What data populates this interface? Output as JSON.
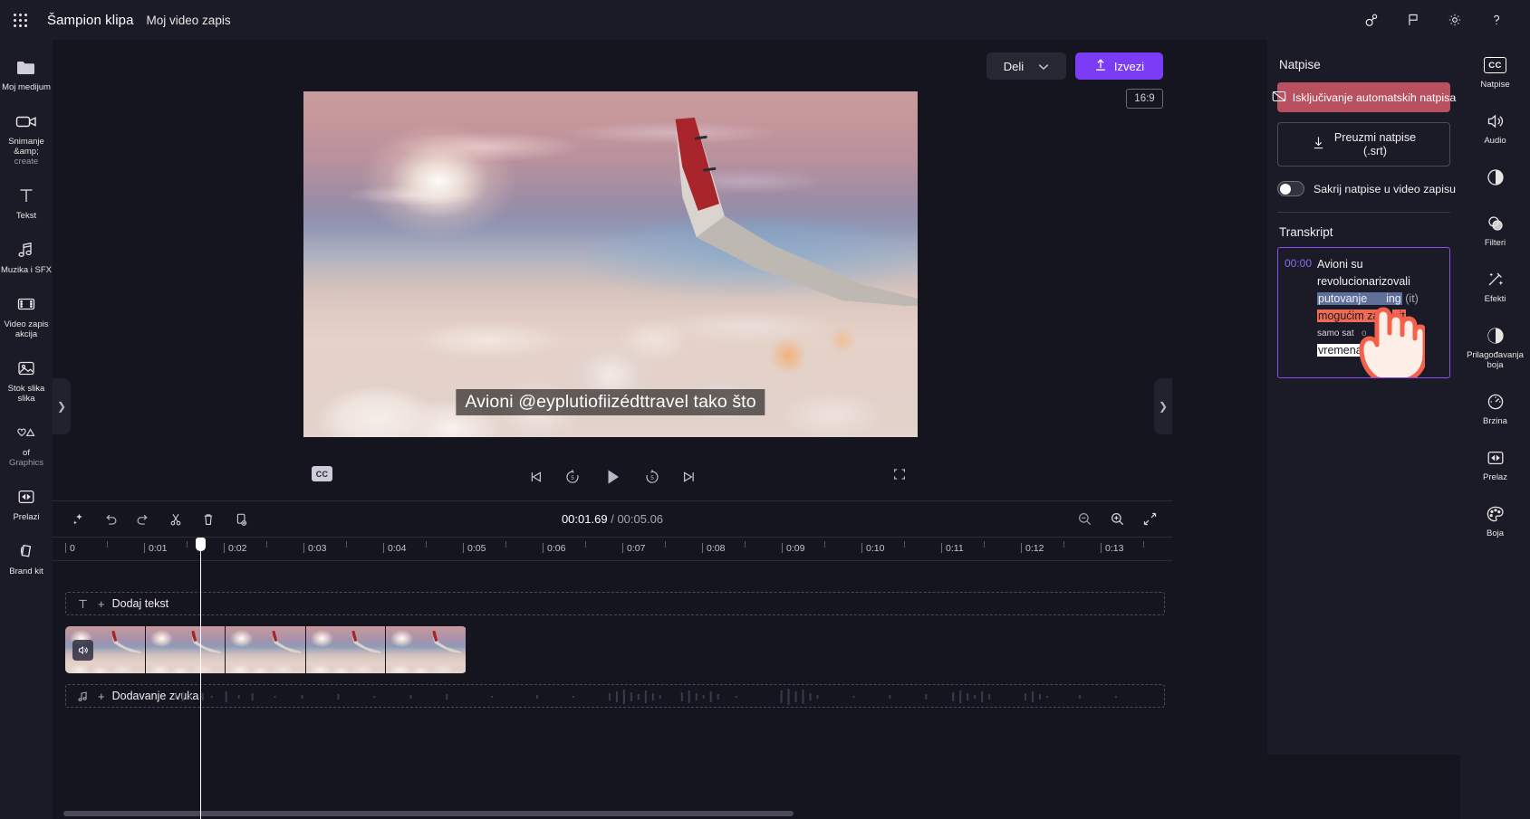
{
  "header": {
    "app_title": "Šampion klipa",
    "project_title": "Moj video zapis",
    "icons": [
      {
        "name": "people-share-icon",
        "label": "Deljenje"
      },
      {
        "name": "flag-feedback-icon",
        "label": "Povratne informacije"
      },
      {
        "name": "gear-settings-icon",
        "label": "Postavke"
      },
      {
        "name": "help-question-icon",
        "label": "Pomoć"
      }
    ]
  },
  "left_rail": {
    "items": [
      {
        "label": "Moj medijum",
        "icon": "folder-icon"
      },
      {
        "label": "Snimanje &amp;",
        "sub": "create",
        "icon": "camera-video-icon"
      },
      {
        "label": "Tekst",
        "icon": "text-t-icon"
      },
      {
        "label": "Muzika i SFX",
        "icon": "music-note-icon"
      },
      {
        "label": "Video zapis akcija",
        "icon": "film-strip-icon"
      },
      {
        "label": "Stok slika",
        "sub": "slika",
        "icon": "image-picture-icon"
      },
      {
        "label": "of",
        "sub": "Graphics",
        "icon": "heart-triangle-icon"
      },
      {
        "label": "Prelazi",
        "icon": "transition-icon"
      },
      {
        "label": "Brand kit",
        "icon": "brand-kit-icon"
      }
    ]
  },
  "preview": {
    "share_button": "Deli",
    "export_button": "Izvezi",
    "aspect_ratio": "16:9",
    "caption_text": "Avioni @eyplutiofiizédttravel tako što"
  },
  "playback": {
    "cc_label": "CC",
    "controls": [
      {
        "name": "skip-to-start-button"
      },
      {
        "name": "rewind-5-seconds-button",
        "value": "5"
      },
      {
        "name": "play-button"
      },
      {
        "name": "forward-5-seconds-button",
        "value": "5"
      },
      {
        "name": "skip-to-end-button"
      }
    ],
    "fullscreen": "fullscreen-button"
  },
  "captions_panel": {
    "title": "Natpise",
    "disable_auto_button": "Isključivanje automatskih natpisa",
    "download_srt_line1": "Preuzmi natpise",
    "download_srt_line2": "(.srt)",
    "hide_captions_label": "Sakrij natpise u video zapisu",
    "hide_captions_on": false,
    "transcript_title": "Transkript",
    "transcript": {
      "timestamp": "00:00",
      "lines": [
        {
          "segments": [
            {
              "text": "Avioni su",
              "style": "plain"
            }
          ]
        },
        {
          "segments": [
            {
              "text": "revolucionarizovali",
              "style": "plain"
            }
          ]
        },
        {
          "segments": [
            {
              "text": "putovanje",
              "style": "blue"
            },
            {
              "text": " ",
              "style": "blue"
            },
            {
              "text": "ing",
              "style": "blue"
            },
            {
              "text": " (it)",
              "style": "paren"
            }
          ]
        },
        {
          "segments": [
            {
              "text": "mogućim za",
              "style": "red"
            },
            {
              "text": "j u",
              "style": "plain"
            },
            {
              "text": "  it",
              "style": "red"
            }
          ]
        },
        {
          "segments": [
            {
              "text": "samo sat",
              "style": "small"
            }
          ]
        },
        {
          "segments": [
            {
              "text": "vremena. it",
              "style": "white"
            }
          ]
        }
      ]
    },
    "accent_border": "#8a4ff0",
    "danger_color": "#b8505f"
  },
  "right_rail": {
    "items": [
      {
        "label": "Natpise",
        "icon": "cc-captions-icon",
        "active": true
      },
      {
        "label": "Audio",
        "icon": "speaker-audio-icon"
      },
      {
        "label": "",
        "icon": "contrast-circle-icon"
      },
      {
        "label": "Filteri",
        "icon": "filters-overlap-icon"
      },
      {
        "label": "Efekti",
        "icon": "magic-wand-effects-icon"
      },
      {
        "label": "Prilagođavanja",
        "sub": "boja",
        "icon": "color-adjust-icon"
      },
      {
        "label": "Brzina",
        "icon": "speedometer-icon"
      },
      {
        "label": "Prelaz",
        "icon": "transition-icon"
      },
      {
        "label": "Boja",
        "icon": "palette-color-icon"
      }
    ]
  },
  "timeline": {
    "tools": [
      {
        "name": "ai-sparkle-button"
      },
      {
        "name": "undo-button"
      },
      {
        "name": "redo-button"
      },
      {
        "name": "split-scissors-button"
      },
      {
        "name": "delete-trash-button"
      },
      {
        "name": "duplicate-button"
      }
    ],
    "current_time": "00:01.69",
    "separator": "/",
    "total_time": "00:05.06",
    "zoom_controls": [
      {
        "name": "zoom-out-button"
      },
      {
        "name": "zoom-in-button"
      },
      {
        "name": "fit-to-screen-button"
      }
    ],
    "ruler_ticks": [
      "0",
      "0:01",
      "0:02",
      "0:03",
      "0:04",
      "0:05",
      "0:06",
      "0:07",
      "0:08",
      "0:09",
      "0:10",
      "0:11",
      "0:12",
      "0:13"
    ],
    "text_track_label": "Dodaj tekst",
    "audio_track_label": "Dodavanje zvuka",
    "video_clip_thumbnails": 5
  }
}
